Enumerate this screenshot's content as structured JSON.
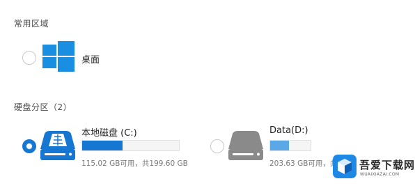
{
  "sections": {
    "common": {
      "title": "常用区域"
    },
    "disk": {
      "title": "硬盘分区（2）"
    }
  },
  "common_items": [
    {
      "label": "桌面",
      "icon": "windows-logo-icon",
      "selected": false
    }
  ],
  "drives": [
    {
      "name": "本地磁盘 (C:)",
      "icon": "drive-icon",
      "selected": true,
      "space_text": "115.02 GB可用，共199.60 GB",
      "used_fraction": 0.42,
      "bar_color": "#1677d2"
    },
    {
      "name": "Data(D:)",
      "icon": "drive-icon",
      "selected": false,
      "space_text": "203.63 GB可用，共",
      "used_fraction": 0.46,
      "bar_color": "#5aa8e6"
    }
  ],
  "colors": {
    "accent": "#1677d2",
    "windows_blue": "#1a8ee1",
    "drive_selected": "#1677d2",
    "drive_unselected": "#8a8a8a"
  },
  "watermark": {
    "text": "吾爱下载网",
    "sub": "WUAIXIAZAI.COM",
    "icon": "cube-logo-icon"
  }
}
